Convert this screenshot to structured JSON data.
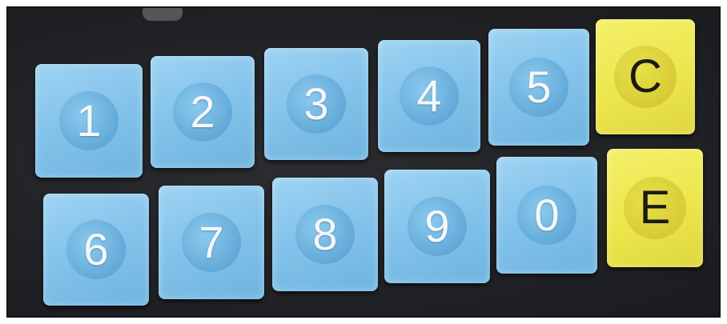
{
  "keypad": {
    "row1": [
      "1",
      "2",
      "3",
      "4",
      "5"
    ],
    "row2": [
      "6",
      "7",
      "8",
      "9",
      "0"
    ],
    "clear_label": "C",
    "enter_label": "E"
  },
  "colors": {
    "panel": "#222327",
    "number_key": "#82c2ea",
    "function_key": "#ece64c"
  }
}
